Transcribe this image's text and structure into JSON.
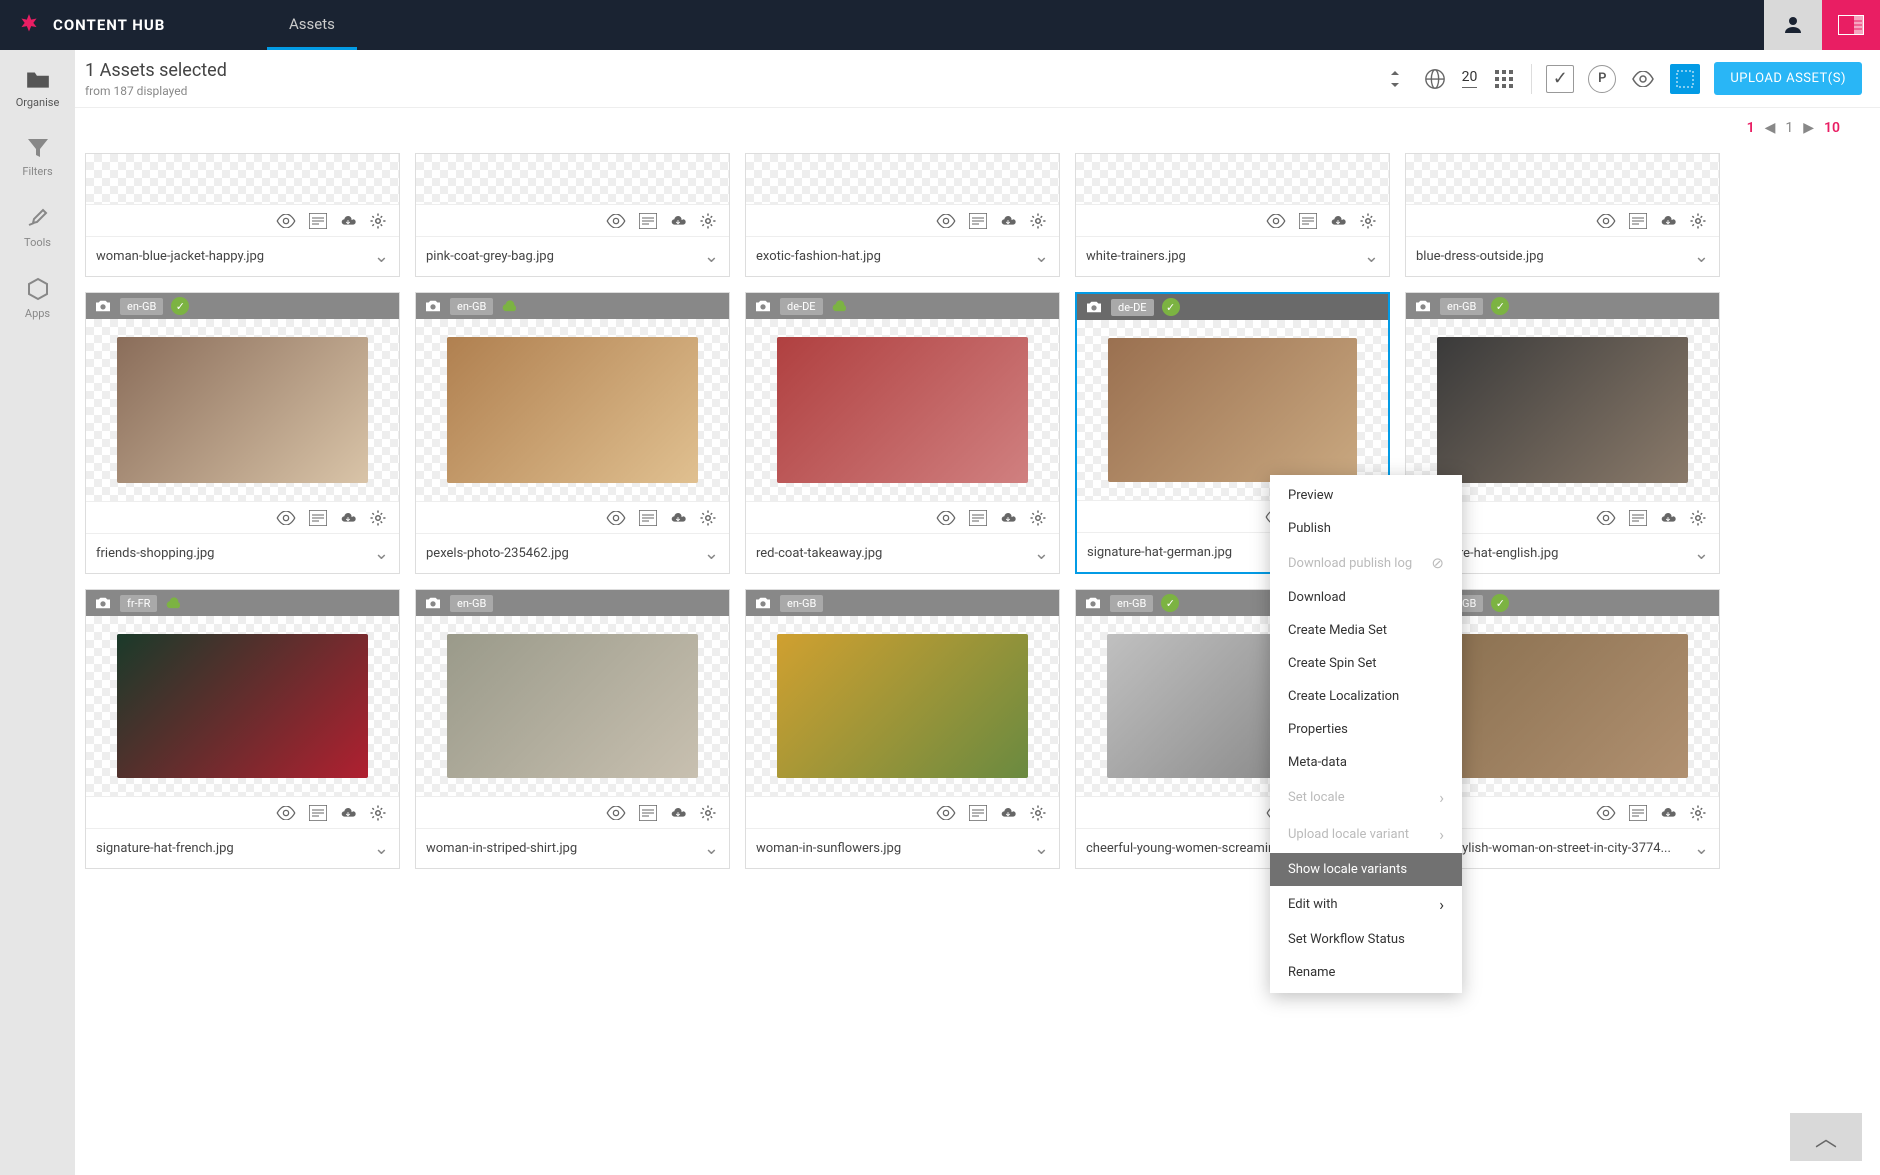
{
  "brand": "CONTENT HUB",
  "nav": {
    "assets": "Assets"
  },
  "sidebar": [
    {
      "key": "organise",
      "label": "Organise"
    },
    {
      "key": "filters",
      "label": "Filters"
    },
    {
      "key": "tools",
      "label": "Tools"
    },
    {
      "key": "apps",
      "label": "Apps"
    }
  ],
  "selection": {
    "title": "1 Assets selected",
    "sub": "from 187 displayed"
  },
  "toolbar": {
    "page_size": "20",
    "upload": "UPLOAD ASSET(S)"
  },
  "pagination": {
    "current_set": "1",
    "current": "1",
    "total": "10"
  },
  "context_menu": {
    "items": [
      {
        "label": "Preview"
      },
      {
        "label": "Publish"
      },
      {
        "label": "Download publish log",
        "disabled": true,
        "icon": "no"
      },
      {
        "label": "Download"
      },
      {
        "label": "Create Media Set"
      },
      {
        "label": "Create Spin Set"
      },
      {
        "label": "Create Localization"
      },
      {
        "label": "Properties"
      },
      {
        "label": "Meta-data"
      },
      {
        "label": "Set locale",
        "disabled": true,
        "submenu": true
      },
      {
        "label": "Upload locale variant",
        "disabled": true,
        "submenu": true
      },
      {
        "label": "Show locale variants",
        "hover": true
      },
      {
        "label": "Edit with",
        "submenu": true
      },
      {
        "label": "Set Workflow Status"
      },
      {
        "label": "Rename"
      }
    ]
  },
  "assets_row1": [
    {
      "name": "woman-blue-jacket-happy.jpg"
    },
    {
      "name": "pink-coat-grey-bag.jpg"
    },
    {
      "name": "exotic-fashion-hat.jpg"
    },
    {
      "name": "white-trainers.jpg"
    },
    {
      "name": "blue-dress-outside.jpg"
    }
  ],
  "assets_row2": [
    {
      "name": "friends-shopping.jpg",
      "locale": "en-GB",
      "pub": true,
      "c1": "#8a6d5a",
      "c2": "#d9c4a8"
    },
    {
      "name": "pexels-photo-235462.jpg",
      "locale": "en-GB",
      "pub": false,
      "c1": "#b08050",
      "c2": "#e0c090"
    },
    {
      "name": "red-coat-takeaway.jpg",
      "locale": "de-DE",
      "pub": false,
      "c1": "#b04040",
      "c2": "#d08080"
    },
    {
      "name": "signature-hat-german.jpg",
      "locale": "de-DE",
      "pub": true,
      "selected": true,
      "c1": "#9a7050",
      "c2": "#c9a880"
    },
    {
      "name": "signature-hat-english.jpg",
      "locale": "en-GB",
      "pub": true,
      "c1": "#3a3a3a",
      "c2": "#8a7a6a"
    }
  ],
  "assets_row3": [
    {
      "name": "signature-hat-french.jpg",
      "locale": "fr-FR",
      "pub": false,
      "c1": "#1a3a2a",
      "c2": "#b02030"
    },
    {
      "name": "woman-in-striped-shirt.jpg",
      "locale": "en-GB",
      "pub": false,
      "nocloud": true,
      "c1": "#9a9a8a",
      "c2": "#c8c0b0"
    },
    {
      "name": "woman-in-sunflowers.jpg",
      "locale": "en-GB",
      "pub": false,
      "nocloud": true,
      "c1": "#d0a030",
      "c2": "#6a8a40"
    },
    {
      "name": "cheerful-young-women-screaming-into-lou...",
      "locale": "en-GB",
      "pub": true,
      "c1": "#c0c0c0",
      "c2": "#808080"
    },
    {
      "name": "joyful-stylish-woman-on-street-in-city-3774...",
      "locale": "en-GB",
      "pub": true,
      "c1": "#8a7050",
      "c2": "#b09070"
    }
  ]
}
